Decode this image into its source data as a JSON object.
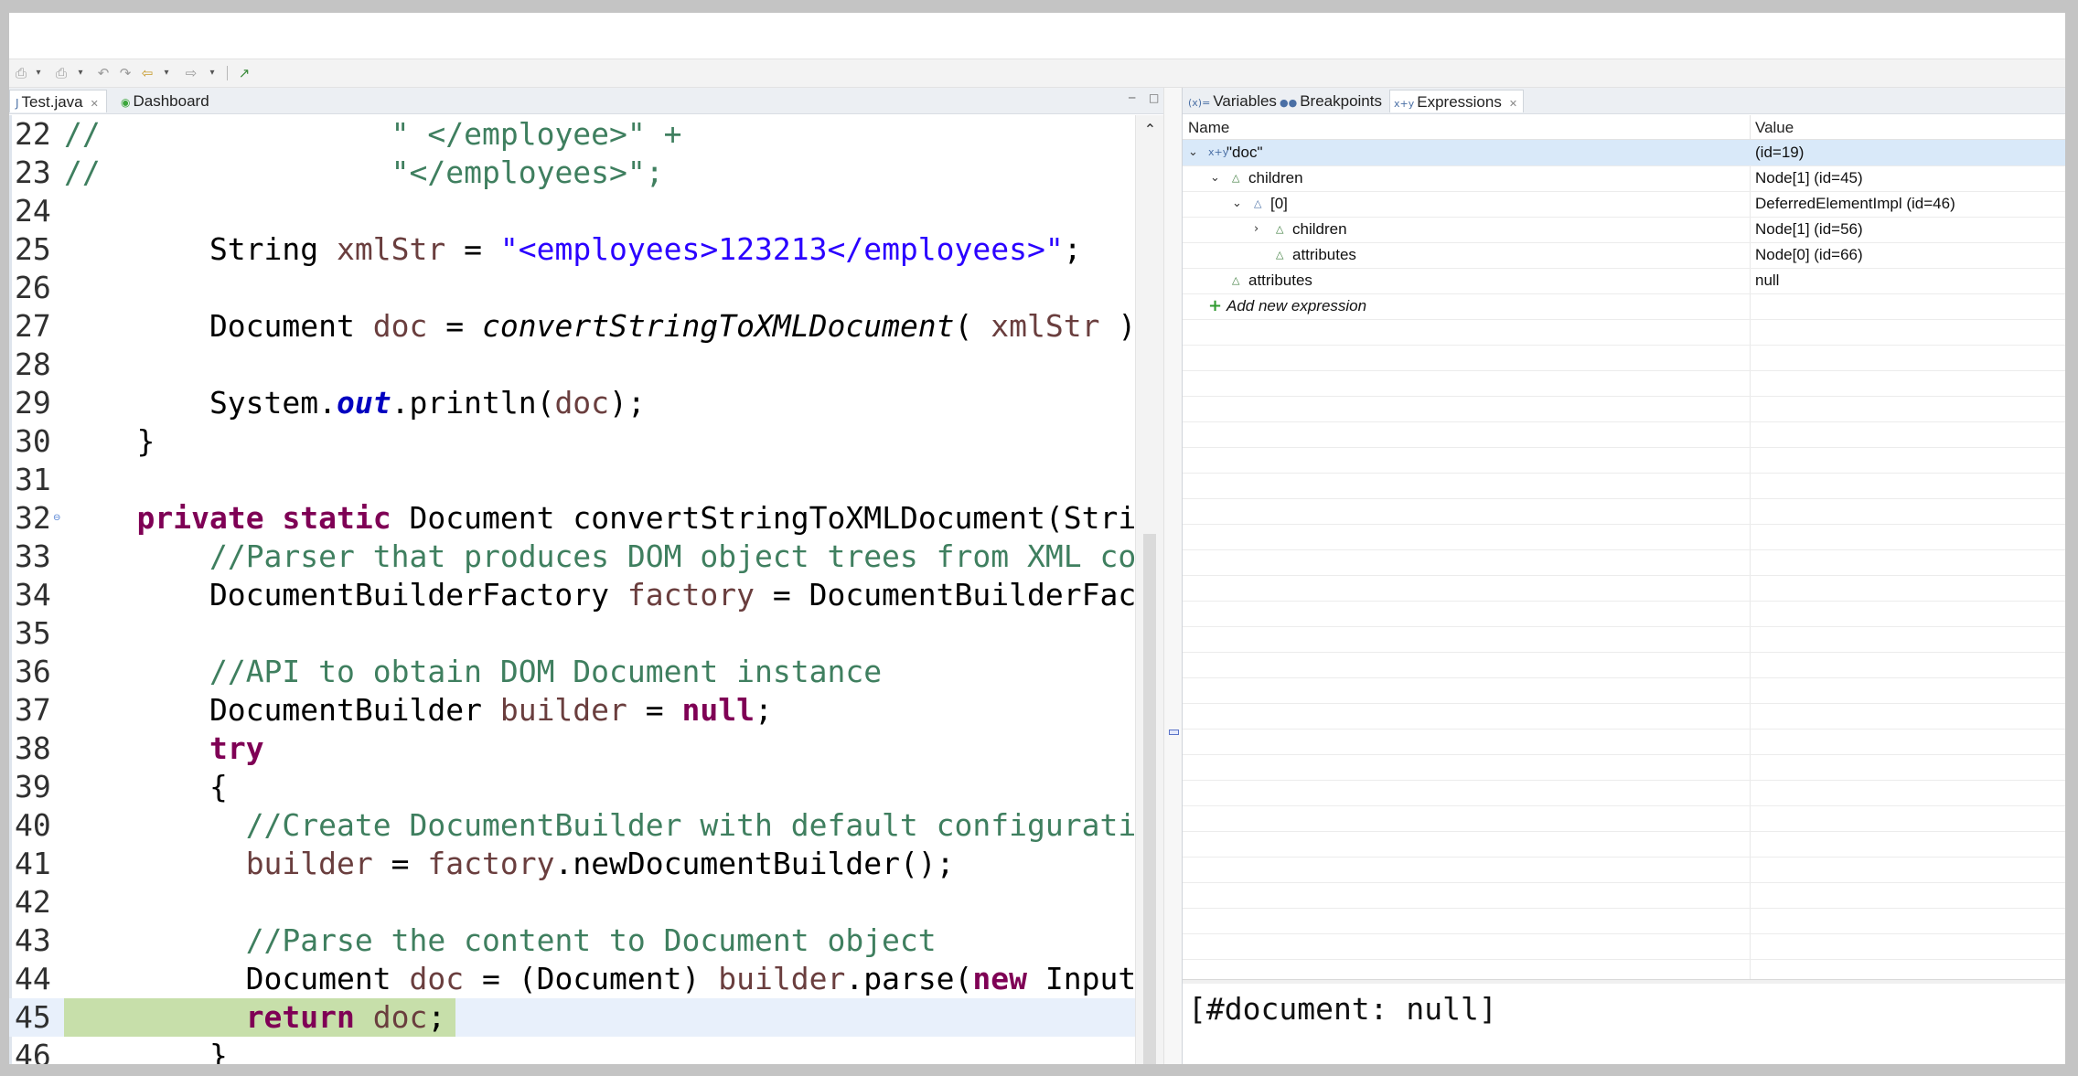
{
  "toolbar": {
    "icons": [
      "new-icon",
      "dropdown-icon",
      "save-icon",
      "dropdown-icon",
      "back-edit-icon",
      "forward-edit-icon",
      "back-icon",
      "dropdown-icon",
      "forward-icon",
      "dropdown-icon",
      "external-tool-icon"
    ]
  },
  "editor": {
    "tabs": [
      {
        "label": "Test.java",
        "icon": "java-file-icon",
        "active": true
      },
      {
        "label": "Dashboard",
        "icon": "dashboard-icon",
        "active": false
      }
    ],
    "lines": [
      {
        "n": "22"
      },
      {
        "n": "23"
      },
      {
        "n": "24"
      },
      {
        "n": "25"
      },
      {
        "n": "26"
      },
      {
        "n": "27"
      },
      {
        "n": "28"
      },
      {
        "n": "29"
      },
      {
        "n": "30"
      },
      {
        "n": "31"
      },
      {
        "n": "32"
      },
      {
        "n": "33"
      },
      {
        "n": "34"
      },
      {
        "n": "35"
      },
      {
        "n": "36"
      },
      {
        "n": "37"
      },
      {
        "n": "38"
      },
      {
        "n": "39"
      },
      {
        "n": "40"
      },
      {
        "n": "41"
      },
      {
        "n": "42"
      },
      {
        "n": "43"
      },
      {
        "n": "44"
      },
      {
        "n": "45"
      },
      {
        "n": "46"
      }
    ],
    "code": {
      "l22": [
        "//",
        "                \" </employee>\" +"
      ],
      "l23": [
        "//",
        "                \"</employees>\";"
      ],
      "l25": [
        "        String ",
        "xmlStr",
        " = ",
        "\"<employees>123213</employees>\"",
        ";"
      ],
      "l27": [
        "        Document ",
        "doc",
        " = ",
        "convertStringToXMLDocument",
        "( ",
        "xmlStr",
        " );"
      ],
      "l29": [
        "        System.",
        "out",
        ".println(",
        "doc",
        ");"
      ],
      "l30": [
        "    }"
      ],
      "l32": [
        "    ",
        "private",
        " ",
        "static",
        " Document convertStringToXMLDocument(String xmlString)"
      ],
      "l33": [
        "        ",
        "//Parser that produces DOM object trees from XML content"
      ],
      "l34": [
        "        DocumentBuilderFactory ",
        "factory",
        " = DocumentBuilderFactory.newInstance();"
      ],
      "l36": [
        "        ",
        "//API to obtain DOM Document instance"
      ],
      "l37": [
        "        DocumentBuilder ",
        "builder",
        " = ",
        "null",
        ";"
      ],
      "l38": [
        "        ",
        "try"
      ],
      "l39": [
        "        {"
      ],
      "l40": [
        "          ",
        "//Create DocumentBuilder with default configuration"
      ],
      "l41": [
        "          ",
        "builder",
        " = ",
        "factory",
        ".newDocumentBuilder();"
      ],
      "l43": [
        "          ",
        "//Parse the content to Document object"
      ],
      "l44": [
        "          Document ",
        "doc",
        " = (Document) ",
        "builder",
        ".parse(",
        "new",
        " InputSource(new StringReader(xmlString)));"
      ],
      "l45": [
        "          ",
        "return",
        " ",
        "doc",
        ";"
      ],
      "l46": [
        "        }"
      ]
    }
  },
  "debug": {
    "tabs": [
      {
        "label": "Variables",
        "icon": "variables-icon"
      },
      {
        "label": "Breakpoints",
        "icon": "breakpoints-icon"
      },
      {
        "label": "Expressions",
        "icon": "expressions-icon",
        "active": true
      }
    ],
    "columns": {
      "name": "Name",
      "value": "Value"
    },
    "rows": [
      {
        "name": "\"doc\"",
        "value": " (id=19)"
      },
      {
        "name": "children",
        "value": "Node[1]  (id=45)"
      },
      {
        "name": "[0]",
        "value": "DeferredElementImpl  (id=46)"
      },
      {
        "name": "children",
        "value": "Node[1]  (id=56)"
      },
      {
        "name": "attributes",
        "value": "Node[0]  (id=66)"
      },
      {
        "name": "attributes",
        "value": "null"
      },
      {
        "name": "Add new expression",
        "value": ""
      }
    ],
    "detail": "[#document: null]"
  },
  "colors": {
    "current_line": "#c7dfaa",
    "keyword": "#7f0055",
    "comment": "#3f7f5f",
    "string": "#2a00ff",
    "local_var": "#6a3e3e",
    "static_field": "#0000c0",
    "selection": "#d9e9f9"
  }
}
